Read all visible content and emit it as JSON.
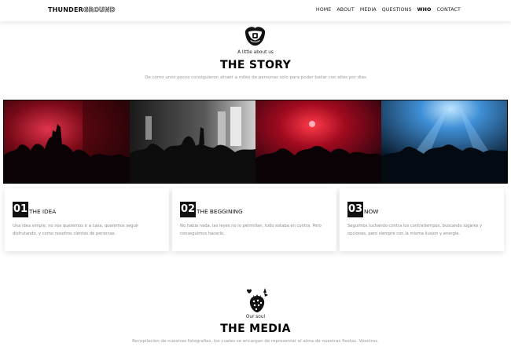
{
  "header": {
    "logo_solid": "THUNDER",
    "logo_outline": "GROUND",
    "nav": [
      "HOME",
      "ABOUT",
      "MEDIA",
      "QUESTIONS",
      "WHO",
      "CONTACT"
    ],
    "active_nav": "WHO"
  },
  "story": {
    "icon": "mouth-icon",
    "eyebrow": "A little about us",
    "title": "THE STORY",
    "subtitle": "De como unos pocos consiguieron atraer a miles de personas solo para poder bailar con ellos por dias"
  },
  "photos": [
    {
      "name": "photo-red-crowd",
      "tint": "#b3122a"
    },
    {
      "name": "photo-bw-crowd",
      "tint": "#9a9a9a"
    },
    {
      "name": "photo-red-club",
      "tint": "#c01026"
    },
    {
      "name": "photo-blue-lights",
      "tint": "#3f8fd6"
    }
  ],
  "cards": [
    {
      "number": "01",
      "title": "THE IDEA",
      "text": "Una idea simple, no nos queremos ir a casa, queremos seguir disfrutando, y como nosotros cientos de personas."
    },
    {
      "number": "02",
      "title": "THE BEGGINING",
      "text": "No habia nada, las leyes no lo permitian, todo estaba en contra. Pero conseguimos hacerlo."
    },
    {
      "number": "03",
      "title": "NOW",
      "text": "Seguimos luchando contra los contratiempos, buscando lugares y opciones, pero siempre con la misma ilusion y energia."
    }
  ],
  "media": {
    "icon": "strawberry-icon",
    "eyebrow": "Our soul",
    "title": "THE MEDIA",
    "subtitle": "Recopilacion de nuestras fotografias, los cuales se encargan de representar el alma de nuestras fiestas. Vosotros."
  }
}
